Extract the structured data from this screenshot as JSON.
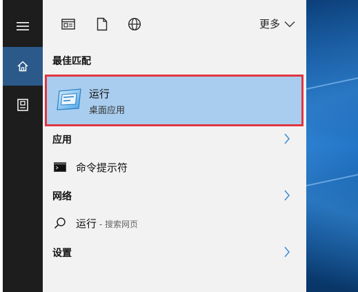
{
  "toolbar": {
    "icons": [
      "news-icon",
      "document-icon",
      "globe-icon"
    ],
    "more_label": "更多"
  },
  "best_match": {
    "header": "最佳匹配",
    "title": "运行",
    "subtitle": "桌面应用"
  },
  "apps": {
    "header": "应用",
    "items": [
      {
        "label": "命令提示符",
        "icon": "cmd-icon"
      }
    ]
  },
  "web": {
    "header": "网络",
    "items": [
      {
        "label": "运行",
        "suffix": " - 搜索网页",
        "icon": "search-icon"
      }
    ]
  },
  "settings": {
    "header": "设置"
  },
  "colors": {
    "rail": "#1d1d1d",
    "rail_active": "#2b5a8a",
    "panel": "#f2f2f2",
    "highlight": "#a9cdee",
    "highlight_border": "#e03540",
    "chevron": "#3f8fd6"
  }
}
